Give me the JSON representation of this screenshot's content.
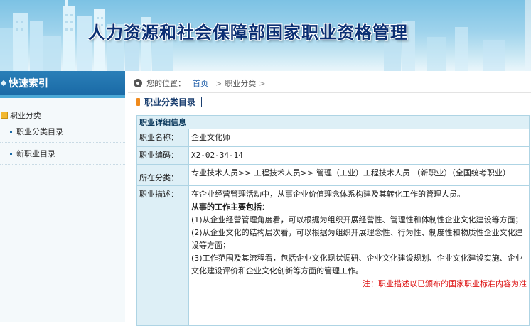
{
  "colors": {
    "banner_title": "#0b2f73",
    "sidebar_header": "#1a6aa6",
    "label_cell": "#ddeff6",
    "table_border": "#aed4e4",
    "note": "#dd1111",
    "tag_orange": "#f08a1c"
  },
  "header": {
    "title": "人力资源和社会保障部国家职业资格管理"
  },
  "sidebar": {
    "title": "快速索引",
    "category": "职业分类",
    "items": [
      {
        "label": "职业分类目录"
      },
      {
        "label": "新职业目录"
      }
    ]
  },
  "breadcrumb": {
    "prefix": "您的位置：",
    "home": "首页",
    "sep1": ">",
    "current": "职业分类",
    "sep2": ">",
    "icon": "location-pin-icon"
  },
  "section": {
    "title": "职业分类目录"
  },
  "detail": {
    "heading": "职业详细信息",
    "rows": {
      "name": {
        "label": "职业名称：",
        "value": "企业文化师"
      },
      "code": {
        "label": "职业编码：",
        "value": "X2-02-34-14"
      },
      "category": {
        "label": "所在分类：",
        "value": "专业技术人员>> 工程技术人员>> 管理（工业）工程技术人员 （新职业）（全国统考职业）"
      },
      "desc": {
        "label": "职业描述：",
        "intro": "在企业经营管理活动中，从事企业价值理念体系构建及其转化工作的管理人员。",
        "tasks_head": "从事的工作主要包括：",
        "tasks": [
          "(1)从企业经营管理角度看，可以根据为组织开展经营性、管理性和体制性企业文化建设等方面；",
          "(2)从企业文化的结构层次看，可以根据为组织开展理念性、行为性、制度性和物质性企业文化建设等方面；",
          "(3)工作范围及其流程看，包括企业文化现状调研、企业文化建设规划、企业文化建设实施、企业文化建设评价和企业文化创新等方面的管理工作。"
        ],
        "note": "注：职业描述以已颁布的国家职业标准内容为准"
      }
    }
  }
}
